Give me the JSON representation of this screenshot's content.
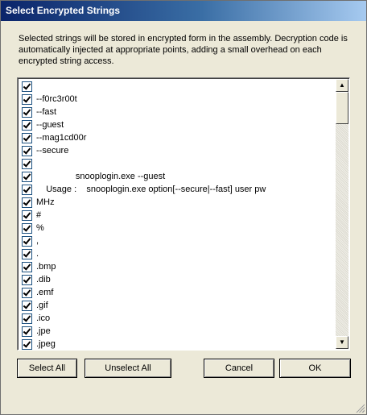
{
  "window": {
    "title": "Select Encrypted Strings"
  },
  "description": "Selected strings will be stored in encrypted form in the assembly.  Decryption code is automatically injected at appropriate points, adding a small overhead on each encrypted string access.",
  "list": {
    "items": [
      {
        "label": "",
        "checked": true
      },
      {
        "label": "--f0rc3r00t",
        "checked": true
      },
      {
        "label": "--fast",
        "checked": true
      },
      {
        "label": "--guest",
        "checked": true
      },
      {
        "label": "--mag1cd00r",
        "checked": true
      },
      {
        "label": "--secure",
        "checked": true
      },
      {
        "label": "",
        "checked": true
      },
      {
        "label": "                snooplogin.exe --guest",
        "checked": true
      },
      {
        "label": "    Usage :    snooplogin.exe option[--secure|--fast] user pw",
        "checked": true
      },
      {
        "label": "MHz",
        "checked": true
      },
      {
        "label": "#",
        "checked": true
      },
      {
        "label": "%",
        "checked": true
      },
      {
        "label": ",",
        "checked": true
      },
      {
        "label": ".",
        "checked": true
      },
      {
        "label": ".bmp",
        "checked": true
      },
      {
        "label": ".dib",
        "checked": true
      },
      {
        "label": ".emf",
        "checked": true
      },
      {
        "label": ".gif",
        "checked": true
      },
      {
        "label": ".ico",
        "checked": true
      },
      {
        "label": ".jpe",
        "checked": true
      },
      {
        "label": ".jpeg",
        "checked": true
      }
    ]
  },
  "buttons": {
    "select_all": "Select All",
    "unselect_all": "Unselect All",
    "cancel": "Cancel",
    "ok": "OK"
  },
  "scrollbar": {
    "up_icon": "scroll-up-arrow",
    "down_icon": "scroll-down-arrow"
  }
}
